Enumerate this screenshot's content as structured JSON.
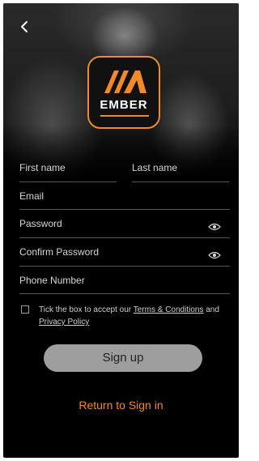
{
  "app": {
    "logo_text": "EMBER",
    "accent": "#f08a2c"
  },
  "header": {
    "back_icon": "chevron-left-icon"
  },
  "form": {
    "first_name_placeholder": "First name",
    "last_name_placeholder": "Last name",
    "email_placeholder": "Email",
    "password_placeholder": "Password",
    "confirm_password_placeholder": "Confirm Password",
    "phone_placeholder": "Phone Number",
    "password_toggle_icon": "eye-icon"
  },
  "terms": {
    "prefix": "Tick the box to accept our",
    "terms_link": "Terms & Conditions",
    "conjunction": "and",
    "privacy_link": "Privacy Policy",
    "checked": false
  },
  "actions": {
    "signup_label": "Sign up",
    "return_label": "Return to Sign in"
  }
}
